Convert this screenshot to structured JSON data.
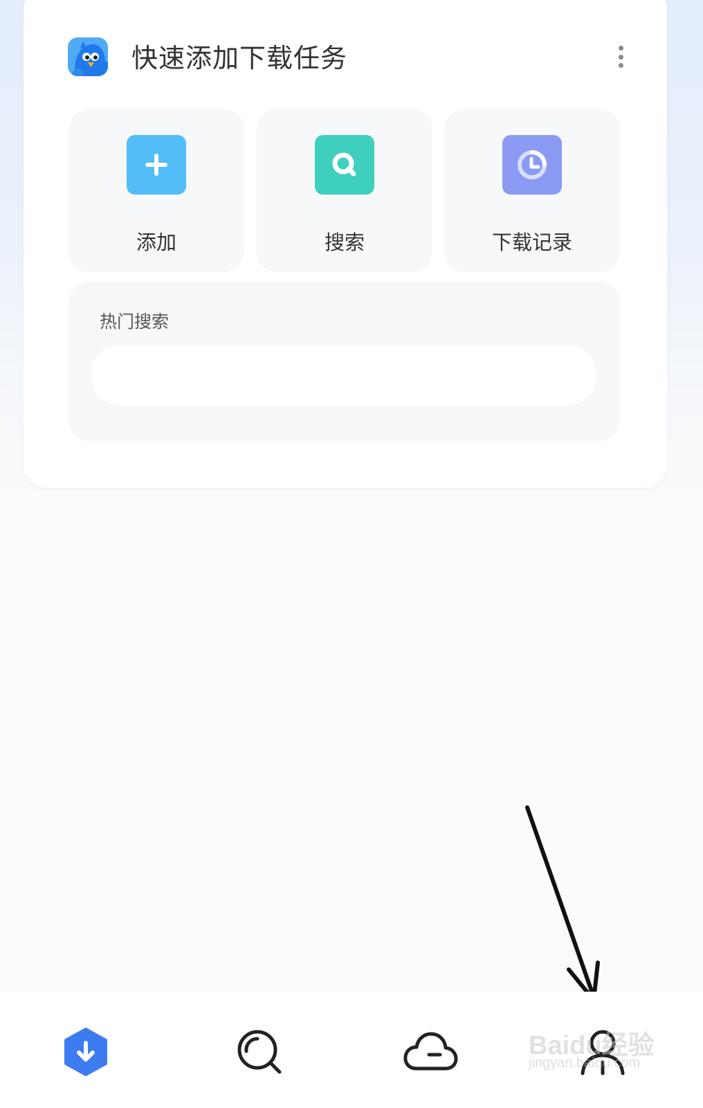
{
  "card": {
    "title": "快速添加下载任务",
    "more_icon": "more-vertical-icon",
    "logo_icon": "bird-logo-icon"
  },
  "quick_actions": [
    {
      "label": "添加",
      "icon": "plus-icon",
      "color": "#52bdf7"
    },
    {
      "label": "搜索",
      "icon": "search-icon",
      "color": "#3ecfbd"
    },
    {
      "label": "下载记录",
      "icon": "clock-icon",
      "color": "#8b9bf3"
    }
  ],
  "hot_search": {
    "title": "热门搜索"
  },
  "bottom_nav": [
    {
      "name": "download",
      "icon": "download-icon",
      "active": true,
      "color": "#3d7cf0"
    },
    {
      "name": "search",
      "icon": "search-icon",
      "active": false
    },
    {
      "name": "cloud",
      "icon": "cloud-icon",
      "active": false
    },
    {
      "name": "profile",
      "icon": "user-icon",
      "active": false
    }
  ],
  "watermark": {
    "main": "Baidu经验",
    "sub": "jingyan.baidu.com"
  }
}
